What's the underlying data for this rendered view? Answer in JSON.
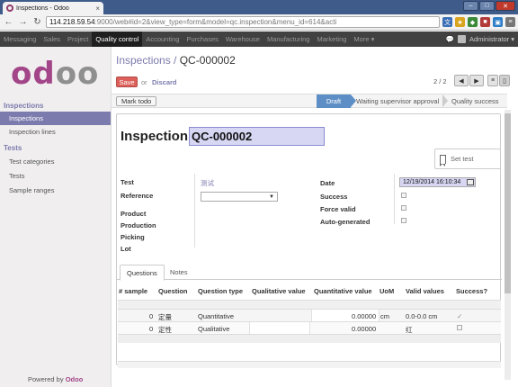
{
  "browser": {
    "tab_title": "Inspections - Odoo",
    "url_host": "114.218.59.54",
    "url_rest": ":9000/web#id=2&view_type=form&model=qc.inspection&menu_id=614&acti"
  },
  "topmenu": {
    "items": [
      "Messaging",
      "Sales",
      "Project",
      "Quality control",
      "Accounting",
      "Purchases",
      "Warehouse",
      "Manufacturing",
      "Marketing",
      "More ▾"
    ],
    "active_index": 3,
    "user": "Administrator ▾"
  },
  "sidebar": {
    "sections": [
      {
        "title": "Inspections",
        "items": [
          "Inspections",
          "Inspection lines"
        ]
      },
      {
        "title": "Tests",
        "items": [
          "Test categories",
          "Tests",
          "Sample ranges"
        ]
      }
    ],
    "active_item": "Inspections",
    "powered_prefix": "Powered by ",
    "powered_brand": "Odoo"
  },
  "header": {
    "breadcrumb_parent": "Inspections",
    "breadcrumb_sep": " / ",
    "breadcrumb_current": "QC-000002",
    "save_label": "Save",
    "or_label": "or",
    "discard_label": "Discard",
    "pager": "2 / 2"
  },
  "statusbar": {
    "mark_todo": "Mark todo",
    "stages": [
      "Draft",
      "Waiting supervisor approval",
      "Quality success"
    ],
    "current_stage": "Draft"
  },
  "form": {
    "title_label": "Inspection",
    "name_value": "QC-000002",
    "set_test_label": "Set test",
    "left_fields": {
      "test": {
        "label": "Test",
        "value": "测试"
      },
      "reference": {
        "label": "Reference",
        "value": ""
      },
      "product": {
        "label": "Product"
      },
      "production": {
        "label": "Production"
      },
      "picking": {
        "label": "Picking"
      },
      "lot": {
        "label": "Lot"
      }
    },
    "right_fields": {
      "date": {
        "label": "Date",
        "value": "12/19/2014 16:10:34"
      },
      "success": {
        "label": "Success",
        "checked": false
      },
      "force_valid": {
        "label": "Force valid",
        "checked": false
      },
      "auto_generated": {
        "label": "Auto-generated",
        "checked": false
      }
    }
  },
  "tabs": [
    "Questions",
    "Notes"
  ],
  "active_tab": "Questions",
  "table": {
    "columns": [
      "# sample",
      "Question",
      "Question type",
      "Qualitative value",
      "Quantitative value",
      "UoM",
      "Valid values",
      "Success?"
    ],
    "rows": [
      {
        "sample": "0",
        "question": "定量",
        "type": "Quantitative",
        "qualitative": "",
        "quantitative": "0.00000",
        "uom": "cm",
        "valid": "0.0-0.0 cm",
        "success": true
      },
      {
        "sample": "0",
        "question": "定性",
        "type": "Qualitative",
        "qualitative": "",
        "quantitative": "0.00000",
        "uom": "",
        "valid": "红",
        "success": false
      }
    ]
  },
  "colors": {
    "brand": "#a24689",
    "accent": "#7c7bad",
    "save": "#dc5f59",
    "draft": "#5d8fc6"
  }
}
